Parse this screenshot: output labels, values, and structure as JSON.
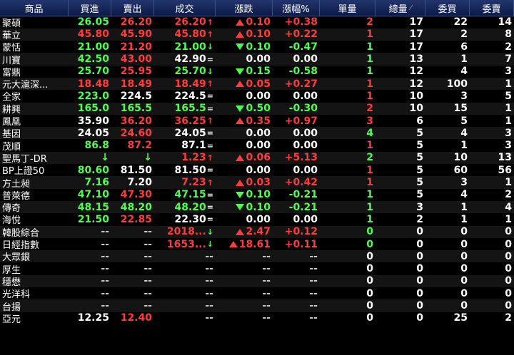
{
  "headers": {
    "name": "商品",
    "bid": "買進",
    "ask": "賣出",
    "last": "成交",
    "change": "漲跌",
    "percent": "漲幅%",
    "volume": "單量",
    "total": "總量",
    "bid_qty": "委買",
    "ask_qty": "委賣"
  },
  "sort_marker": "⁄",
  "colors": {
    "up": "#ff3b3b",
    "down": "#4cff4c",
    "flat": "#ffffff",
    "header_bg": "#1a2b5e"
  },
  "rows": [
    {
      "name": "聚碩",
      "bid": "26.05",
      "bid_c": "g",
      "ask": "26.20",
      "ask_c": "r",
      "last": "26.20",
      "last_c": "r",
      "arrow": "↑",
      "chg": "0.10",
      "dir": "up",
      "pct": "+0.38",
      "pct_c": "r",
      "vol": "2",
      "vol_c": "r",
      "tot": "17",
      "bq": "22",
      "aq": "14"
    },
    {
      "name": "華立",
      "bid": "45.80",
      "bid_c": "r",
      "ask": "45.90",
      "ask_c": "r",
      "last": "45.80",
      "last_c": "r",
      "arrow": "↑",
      "chg": "0.10",
      "dir": "up",
      "pct": "+0.22",
      "pct_c": "r",
      "vol": "1",
      "vol_c": "r",
      "tot": "17",
      "bq": "2",
      "aq": "8"
    },
    {
      "name": "蒙恬",
      "bid": "21.00",
      "bid_c": "g",
      "ask": "21.20",
      "ask_c": "r",
      "last": "21.00",
      "last_c": "g",
      "arrow": "↓",
      "chg": "0.10",
      "dir": "down",
      "pct": "-0.47",
      "pct_c": "g",
      "vol": "1",
      "vol_c": "g",
      "tot": "17",
      "bq": "6",
      "aq": "2"
    },
    {
      "name": "川寶",
      "bid": "42.50",
      "bid_c": "g",
      "ask": "43.00",
      "ask_c": "r",
      "last": "42.90",
      "last_c": "w",
      "arrow": "=",
      "chg": "0.00",
      "dir": "flat",
      "pct": "0.00",
      "pct_c": "w",
      "vol": "1",
      "vol_c": "g",
      "tot": "13",
      "bq": "1",
      "aq": "7"
    },
    {
      "name": "富鼎",
      "bid": "25.70",
      "bid_c": "g",
      "ask": "25.95",
      "ask_c": "r",
      "last": "25.70",
      "last_c": "g",
      "arrow": "↓",
      "chg": "0.15",
      "dir": "down",
      "pct": "-0.58",
      "pct_c": "g",
      "vol": "1",
      "vol_c": "g",
      "tot": "12",
      "bq": "4",
      "aq": "3"
    },
    {
      "name": "元大滬深...",
      "bid": "18.48",
      "bid_c": "r",
      "ask": "18.49",
      "ask_c": "r",
      "last": "18.49",
      "last_c": "r",
      "arrow": "↑",
      "chg": "0.05",
      "dir": "up",
      "pct": "+0.27",
      "pct_c": "r",
      "vol": "1",
      "vol_c": "r",
      "tot": "12",
      "bq": "100",
      "aq": "1"
    },
    {
      "name": "全家",
      "bid": "223.0",
      "bid_c": "g",
      "ask": "224.5",
      "ask_c": "w",
      "last": "224.5",
      "last_c": "w",
      "arrow": "=",
      "chg": "0.00",
      "dir": "flat",
      "pct": "0.00",
      "pct_c": "w",
      "vol": "1",
      "vol_c": "r",
      "tot": "10",
      "bq": "3",
      "aq": "5"
    },
    {
      "name": "耕興",
      "bid": "165.0",
      "bid_c": "g",
      "ask": "165.5",
      "ask_c": "g",
      "last": "165.5",
      "last_c": "g",
      "arrow": "=",
      "chg": "0.50",
      "dir": "down",
      "pct": "-0.30",
      "pct_c": "g",
      "vol": "2",
      "vol_c": "r",
      "tot": "10",
      "bq": "15",
      "aq": "1"
    },
    {
      "name": "鳳凰",
      "bid": "35.90",
      "bid_c": "w",
      "ask": "36.20",
      "ask_c": "r",
      "last": "36.25",
      "last_c": "r",
      "arrow": "↑",
      "chg": "0.35",
      "dir": "up",
      "pct": "+0.97",
      "pct_c": "r",
      "vol": "3",
      "vol_c": "r",
      "tot": "6",
      "bq": "5",
      "aq": "1"
    },
    {
      "name": "基因",
      "bid": "24.05",
      "bid_c": "w",
      "ask": "24.60",
      "ask_c": "r",
      "last": "24.05",
      "last_c": "w",
      "arrow": "=",
      "chg": "0.00",
      "dir": "flat",
      "pct": "0.00",
      "pct_c": "w",
      "vol": "4",
      "vol_c": "g",
      "tot": "5",
      "bq": "4",
      "aq": "3"
    },
    {
      "name": "茂順",
      "bid": "86.8",
      "bid_c": "g",
      "ask": "87.2",
      "ask_c": "r",
      "last": "87.1",
      "last_c": "w",
      "arrow": "=",
      "chg": "0.00",
      "dir": "flat",
      "pct": "0.00",
      "pct_c": "w",
      "vol": "1",
      "vol_c": "r",
      "tot": "5",
      "bq": "1",
      "aq": "3"
    },
    {
      "name": "聖馬丁-DR",
      "bid": "↓",
      "bid_c": "g",
      "ask": "↓",
      "ask_c": "g",
      "last": "1.23",
      "last_c": "r",
      "arrow": "↑",
      "chg": "0.06",
      "dir": "up",
      "pct": "+5.13",
      "pct_c": "r",
      "vol": "2",
      "vol_c": "g",
      "tot": "5",
      "bq": "10",
      "aq": "13"
    },
    {
      "name": "BP上證50",
      "bid": "80.60",
      "bid_c": "g",
      "ask": "81.50",
      "ask_c": "w",
      "last": "81.50",
      "last_c": "w",
      "arrow": "=",
      "chg": "0.00",
      "dir": "flat",
      "pct": "0.00",
      "pct_c": "w",
      "vol": "1",
      "vol_c": "r",
      "tot": "5",
      "bq": "60",
      "aq": "56"
    },
    {
      "name": "方土昶",
      "bid": "7.16",
      "bid_c": "g",
      "ask": "7.20",
      "ask_c": "w",
      "last": "7.23",
      "last_c": "r",
      "arrow": "↑",
      "chg": "0.03",
      "dir": "up",
      "pct": "+0.42",
      "pct_c": "r",
      "vol": "1",
      "vol_c": "r",
      "tot": "5",
      "bq": "3",
      "aq": "1"
    },
    {
      "name": "普萊德",
      "bid": "47.10",
      "bid_c": "g",
      "ask": "47.30",
      "ask_c": "r",
      "last": "47.15",
      "last_c": "g",
      "arrow": "=",
      "chg": "0.10",
      "dir": "down",
      "pct": "-0.21",
      "pct_c": "g",
      "vol": "1",
      "vol_c": "g",
      "tot": "5",
      "bq": "4",
      "aq": "2"
    },
    {
      "name": "傳奇",
      "bid": "48.15",
      "bid_c": "g",
      "ask": "48.20",
      "ask_c": "g",
      "last": "48.20",
      "last_c": "g",
      "arrow": "=",
      "chg": "0.10",
      "dir": "down",
      "pct": "-0.21",
      "pct_c": "g",
      "vol": "1",
      "vol_c": "g",
      "tot": "3",
      "bq": "1",
      "aq": "4"
    },
    {
      "name": "海悅",
      "bid": "21.50",
      "bid_c": "g",
      "ask": "22.85",
      "ask_c": "r",
      "last": "22.30",
      "last_c": "w",
      "arrow": "=",
      "chg": "0.00",
      "dir": "flat",
      "pct": "0.00",
      "pct_c": "w",
      "vol": "1",
      "vol_c": "g",
      "tot": "2",
      "bq": "1",
      "aq": "1"
    },
    {
      "name": "韓股綜合",
      "bid": "--",
      "bid_c": "d",
      "ask": "--",
      "ask_c": "d",
      "last": "2018...",
      "last_c": "r",
      "arrow": "↓",
      "chg": "2.47",
      "dir": "up",
      "pct": "+0.12",
      "pct_c": "r",
      "vol": "0",
      "vol_c": "g",
      "tot": "0",
      "bq": "0",
      "aq": "0"
    },
    {
      "name": "日經指數",
      "bid": "--",
      "bid_c": "d",
      "ask": "--",
      "ask_c": "d",
      "last": "1653...",
      "last_c": "r",
      "arrow": "↓",
      "chg": "18.61",
      "dir": "up",
      "pct": "+0.11",
      "pct_c": "r",
      "vol": "0",
      "vol_c": "g",
      "tot": "0",
      "bq": "0",
      "aq": "0"
    },
    {
      "name": "大眾銀",
      "bid": "--",
      "bid_c": "d",
      "ask": "--",
      "ask_c": "d",
      "last": "--",
      "last_c": "d",
      "arrow": "",
      "chg": "--",
      "dir": "none",
      "pct": "--",
      "pct_c": "d",
      "vol": "0",
      "vol_c": "w",
      "tot": "0",
      "bq": "0",
      "aq": "0"
    },
    {
      "name": "厚生",
      "bid": "--",
      "bid_c": "d",
      "ask": "--",
      "ask_c": "d",
      "last": "--",
      "last_c": "d",
      "arrow": "",
      "chg": "--",
      "dir": "none",
      "pct": "--",
      "pct_c": "d",
      "vol": "0",
      "vol_c": "w",
      "tot": "0",
      "bq": "0",
      "aq": "0"
    },
    {
      "name": "穩懋",
      "bid": "--",
      "bid_c": "d",
      "ask": "--",
      "ask_c": "d",
      "last": "--",
      "last_c": "d",
      "arrow": "",
      "chg": "--",
      "dir": "none",
      "pct": "--",
      "pct_c": "d",
      "vol": "0",
      "vol_c": "w",
      "tot": "0",
      "bq": "0",
      "aq": "0"
    },
    {
      "name": "光洋科",
      "bid": "--",
      "bid_c": "d",
      "ask": "--",
      "ask_c": "d",
      "last": "--",
      "last_c": "d",
      "arrow": "",
      "chg": "--",
      "dir": "none",
      "pct": "--",
      "pct_c": "d",
      "vol": "0",
      "vol_c": "w",
      "tot": "0",
      "bq": "0",
      "aq": "0"
    },
    {
      "name": "台揚",
      "bid": "--",
      "bid_c": "d",
      "ask": "--",
      "ask_c": "d",
      "last": "--",
      "last_c": "d",
      "arrow": "",
      "chg": "--",
      "dir": "none",
      "pct": "--",
      "pct_c": "d",
      "vol": "0",
      "vol_c": "w",
      "tot": "0",
      "bq": "0",
      "aq": "0"
    },
    {
      "name": "亞元",
      "bid": "12.25",
      "bid_c": "w",
      "ask": "12.40",
      "ask_c": "r",
      "last": "--",
      "last_c": "d",
      "arrow": "",
      "chg": "--",
      "dir": "none",
      "pct": "--",
      "pct_c": "d",
      "vol": "0",
      "vol_c": "w",
      "tot": "0",
      "bq": "25",
      "aq": "2"
    }
  ]
}
